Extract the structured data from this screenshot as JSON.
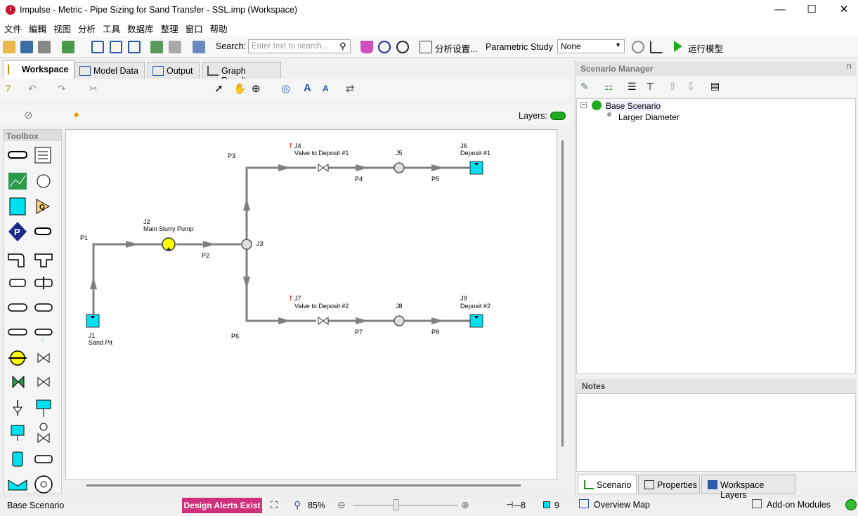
{
  "window": {
    "title": "Impulse - Metric - Pipe Sizing for Sand Transfer - SSL.imp (Workspace)",
    "app_icon": "i",
    "minimize": "—",
    "maximize": "☐",
    "close": "✕"
  },
  "menu": [
    "文件",
    "編輯",
    "视图",
    "分析",
    "工具",
    "数据库",
    "整理",
    "窗口",
    "帮助"
  ],
  "toolbar": {
    "search_label": "Search:",
    "search_placeholder": "Enter text to search...",
    "analysis_settings": "分析设置...",
    "parametric_label": "Parametric Study",
    "parametric_value": "None",
    "run_label": "运行模型"
  },
  "tabs": [
    "Workspace",
    "Model Data",
    "Output",
    "Graph Results"
  ],
  "workspace": {
    "layers_label": "Layers:",
    "toolbox_title": "Toolbox"
  },
  "network": {
    "pipes": [
      {
        "id": "P1",
        "label": "P1"
      },
      {
        "id": "P2",
        "label": "P2"
      },
      {
        "id": "P3",
        "label": "P3"
      },
      {
        "id": "P4",
        "label": "P4"
      },
      {
        "id": "P5",
        "label": "P5"
      },
      {
        "id": "P6",
        "label": "P6"
      },
      {
        "id": "P7",
        "label": "P7"
      },
      {
        "id": "P8",
        "label": "P8"
      }
    ],
    "junctions": [
      {
        "id": "J1",
        "name": "Sand Pit"
      },
      {
        "id": "J2",
        "name": "Main Slurry Pump"
      },
      {
        "id": "J3",
        "name": ""
      },
      {
        "id": "J4",
        "name": "Valve to Deposit #1",
        "flag": "T"
      },
      {
        "id": "J5",
        "name": ""
      },
      {
        "id": "J6",
        "name": "Deposit #1"
      },
      {
        "id": "J7",
        "name": "Valve to Deposit #2",
        "flag": "T"
      },
      {
        "id": "J8",
        "name": ""
      },
      {
        "id": "J9",
        "name": "Deposit #2"
      }
    ]
  },
  "status": {
    "scenario": "Base Scenario",
    "alert": "Design Alerts Exist",
    "zoom": "85%",
    "pipe_count": "8",
    "junction_count": "9",
    "zoom_percent": 85
  },
  "scenario_manager": {
    "title": "Scenario Manager",
    "base": "Base Scenario",
    "child": "Larger Diameter",
    "pin": "⊓"
  },
  "notes": {
    "title": "Notes"
  },
  "right_tabs": [
    "Scenario",
    "Properties",
    "Workspace Layers"
  ],
  "bottom_right": {
    "overview": "Overview Map",
    "addon": "Add-on Modules"
  },
  "colors": {
    "accent_alert": "#d0307a",
    "tank": "#00e0f0",
    "pump": "#ffff00",
    "run": "#22aa22"
  }
}
